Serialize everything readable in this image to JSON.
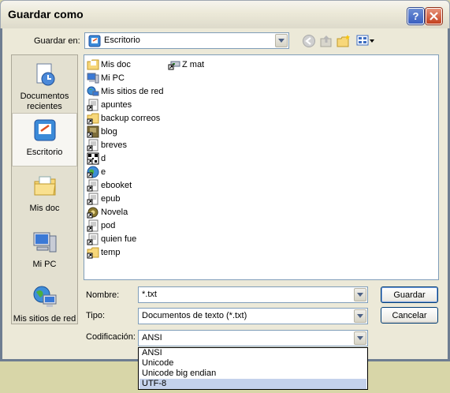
{
  "window": {
    "title": "Guardar como"
  },
  "toolbar": {
    "save_in_label": "Guardar en:",
    "save_in_value": "Escritorio"
  },
  "places": [
    {
      "label": "Documentos recientes",
      "icon": "recent-documents-icon"
    },
    {
      "label": "Escritorio",
      "icon": "desktop-icon"
    },
    {
      "label": "Mis doc",
      "icon": "my-documents-icon"
    },
    {
      "label": "Mi PC",
      "icon": "my-computer-icon"
    },
    {
      "label": "Mis sitios de red",
      "icon": "network-places-icon"
    }
  ],
  "files": [
    {
      "name": "Mis doc",
      "icon": "folder-icon"
    },
    {
      "name": "Mi PC",
      "icon": "computer-icon"
    },
    {
      "name": "Mis sitios de red",
      "icon": "network-icon"
    },
    {
      "name": "apuntes",
      "icon": "shortcut-icon"
    },
    {
      "name": "backup correos",
      "icon": "folder-shortcut-icon"
    },
    {
      "name": "blog",
      "icon": "image-shortcut-icon"
    },
    {
      "name": "breves",
      "icon": "shortcut-icon"
    },
    {
      "name": "d",
      "icon": "qr-shortcut-icon"
    },
    {
      "name": "e",
      "icon": "globe-shortcut-icon"
    },
    {
      "name": "ebooket",
      "icon": "shortcut-icon"
    },
    {
      "name": "epub",
      "icon": "shortcut-icon"
    },
    {
      "name": "Novela",
      "icon": "gear-shortcut-icon"
    },
    {
      "name": "pod",
      "icon": "shortcut-icon"
    },
    {
      "name": "quien fue",
      "icon": "shortcut-icon"
    },
    {
      "name": "temp",
      "icon": "folder-shortcut-icon"
    },
    {
      "name": "Z mat",
      "icon": "drive-shortcut-icon"
    }
  ],
  "form": {
    "name_label": "Nombre:",
    "name_value": "*.txt",
    "type_label": "Tipo:",
    "type_value": "Documentos de texto (*.txt)",
    "encoding_label": "Codificación:",
    "encoding_value": "ANSI",
    "encoding_options": [
      "ANSI",
      "Unicode",
      "Unicode big endian",
      "UTF-8"
    ],
    "encoding_highlighted": "UTF-8"
  },
  "buttons": {
    "save": "Guardar",
    "cancel": "Cancelar"
  }
}
